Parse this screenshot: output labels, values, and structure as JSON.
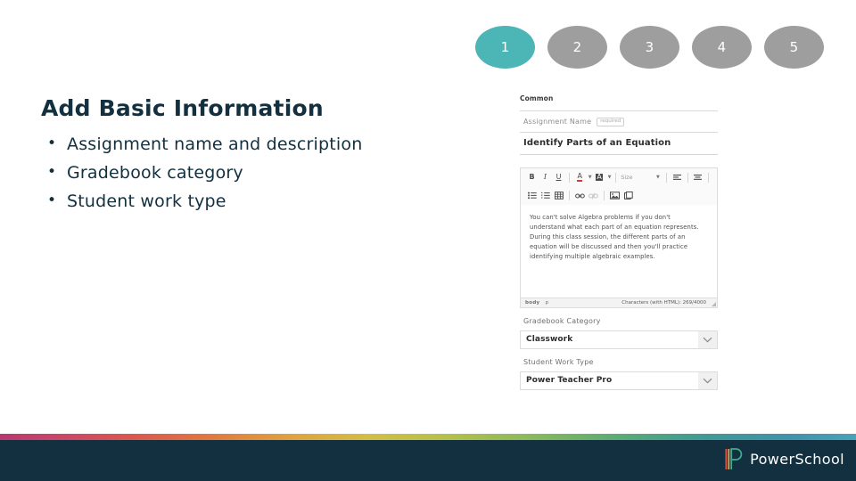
{
  "steps": [
    {
      "label": "1",
      "state": "active"
    },
    {
      "label": "2",
      "state": "inactive"
    },
    {
      "label": "3",
      "state": "inactive"
    },
    {
      "label": "4",
      "state": "inactive"
    },
    {
      "label": "5",
      "state": "inactive"
    }
  ],
  "content": {
    "title": "Add Basic Information",
    "bullets": [
      "Assignment name and description",
      "Gradebook category",
      "Student work type"
    ]
  },
  "screenshot": {
    "section_header": "Common",
    "assignment_name": {
      "label": "Assignment Name",
      "required_chip": "required",
      "value": "Identify Parts of an Equation"
    },
    "editor": {
      "toolbar_row1": [
        {
          "name": "bold",
          "glyph": "B"
        },
        {
          "name": "italic",
          "glyph": "I"
        },
        {
          "name": "underline",
          "glyph": "U"
        },
        {
          "name": "text-color",
          "glyph": "A"
        },
        {
          "name": "highlight-color",
          "glyph": "A"
        }
      ],
      "size_select": "Size",
      "align_left": "align-left",
      "align_center": "align-center",
      "toolbar_row2": [
        {
          "name": "bulleted-list"
        },
        {
          "name": "numbered-list"
        },
        {
          "name": "table"
        },
        {
          "name": "link"
        },
        {
          "name": "unlink"
        },
        {
          "name": "image"
        },
        {
          "name": "template"
        }
      ],
      "body_text": "You can't solve Algebra problems if you don't understand what each part of an equation represents. During this class session, the different parts of an equation will be discussed and then you'll practice identifying multiple algebraic examples.",
      "status_path_body": "body",
      "status_path_p": "p",
      "character_count": "Characters (with HTML): 269/4000"
    },
    "gradebook_category": {
      "label": "Gradebook Category",
      "value": "Classwork"
    },
    "student_work_type": {
      "label": "Student Work Type",
      "value": "Power Teacher Pro"
    }
  },
  "footer": {
    "brand": "PowerSchool"
  },
  "colors": {
    "accent_teal": "#4cb5b5",
    "inactive_gray": "#9e9e9e",
    "navy": "#12303f"
  }
}
